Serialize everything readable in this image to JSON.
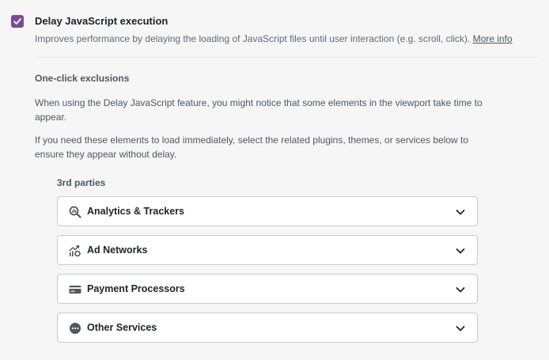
{
  "option": {
    "checked": true,
    "title": "Delay JavaScript execution",
    "description": "Improves performance by delaying the loading of JavaScript files until user interaction (e.g. scroll, click).",
    "more_info_link": "More info"
  },
  "exclusions": {
    "title": "One-click exclusions",
    "paragraph1": "When using the Delay JavaScript feature, you might notice that some elements in the viewport take time to appear.",
    "paragraph2": "If you need these elements to load immediately, select the related plugins, themes, or services below to ensure they appear without delay.",
    "group_title": "3rd parties",
    "items": [
      {
        "label": "Analytics & Trackers",
        "icon": "analytics-search-icon"
      },
      {
        "label": "Ad Networks",
        "icon": "ad-network-icon"
      },
      {
        "label": "Payment Processors",
        "icon": "credit-card-icon"
      },
      {
        "label": "Other Services",
        "icon": "more-dots-icon"
      }
    ]
  },
  "colors": {
    "accent": "#7a4a9b",
    "text": "#1d2327",
    "muted": "#50575e",
    "border": "#c9cbcf",
    "background": "#f6f6f7"
  }
}
